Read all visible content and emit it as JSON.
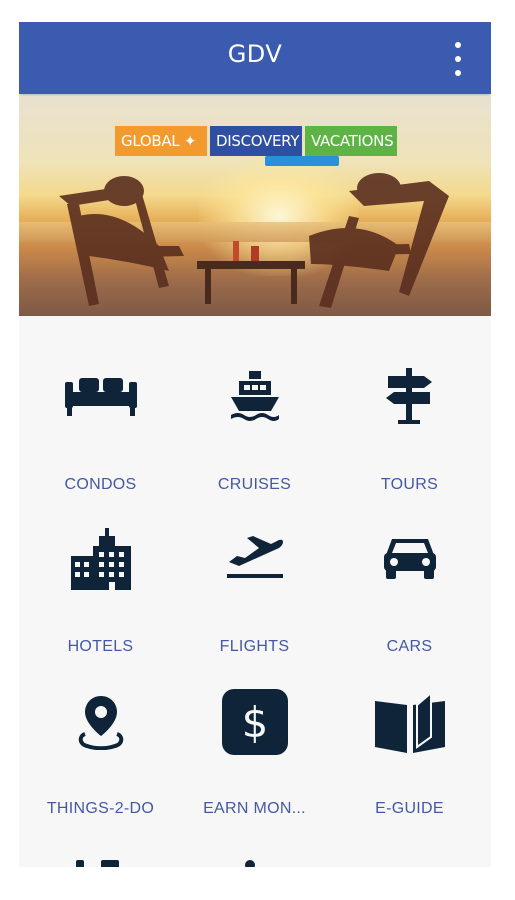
{
  "appbar": {
    "title": "GDV",
    "menu_icon": "more-vert-icon"
  },
  "banner": {
    "logo": {
      "global": "GLOBAL ✦",
      "discovery": "DISCOVERY",
      "vacations": "VACATIONS"
    },
    "colors": {
      "global": "#f39a2e",
      "discovery": "#2f4fa3",
      "vacations": "#5db344"
    }
  },
  "menu": {
    "items": [
      {
        "label": "CONDOS",
        "icon": "sofa-icon"
      },
      {
        "label": "CRUISES",
        "icon": "ship-icon"
      },
      {
        "label": "TOURS",
        "icon": "signpost-icon"
      },
      {
        "label": "HOTELS",
        "icon": "building-icon"
      },
      {
        "label": "FLIGHTS",
        "icon": "plane-departure-icon"
      },
      {
        "label": "CARS",
        "icon": "car-icon"
      },
      {
        "label": "THINGS-2-DO",
        "icon": "location-pin-icon"
      },
      {
        "label": "EARN MON...",
        "icon": "dollar-icon"
      },
      {
        "label": "E-GUIDE",
        "icon": "book-icon"
      }
    ]
  },
  "colors": {
    "appbar": "#3a5bb0",
    "label": "#4458a6",
    "icon": "#0f2438"
  }
}
